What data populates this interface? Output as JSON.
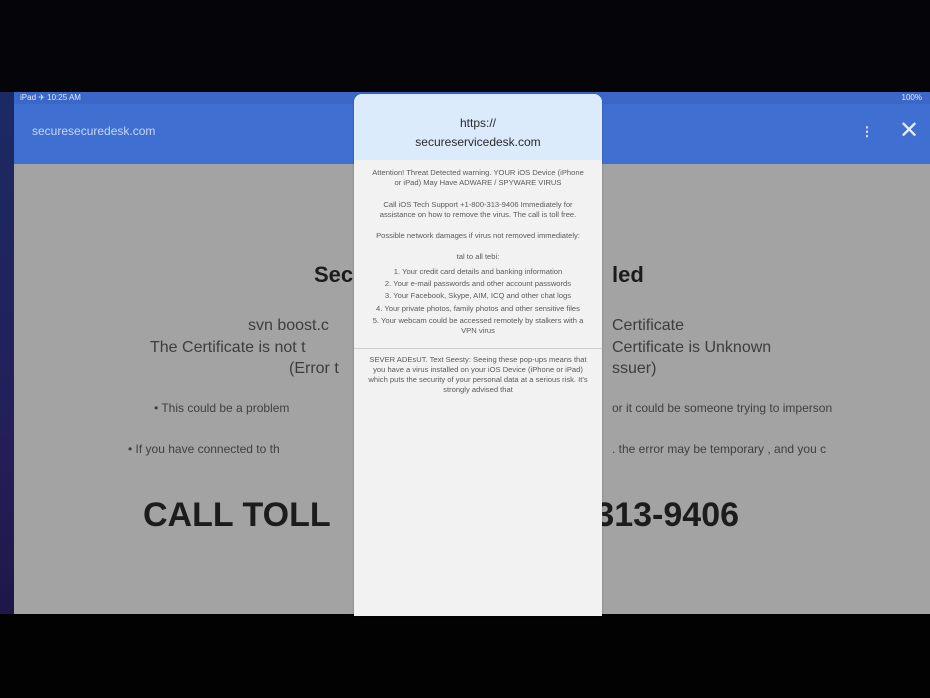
{
  "status_bar": {
    "left": "iPad ✈ 10:25 AM",
    "right": "100%"
  },
  "app_bar": {
    "url": "securesecuredesk.com"
  },
  "page": {
    "heading_left": "Sec",
    "heading_right": "led",
    "cert_lines": [
      {
        "left": "svn boost.c",
        "right": "Certificate"
      },
      {
        "left": "The Certificate is not t",
        "right": "Certificate is Unknown"
      },
      {
        "left": "(Error t",
        "right": "ssuer)"
      }
    ],
    "bullets": [
      {
        "left": "This could be a problem",
        "right": "or it could be someone trying to imperson"
      },
      {
        "left": "If you have connected to th",
        "right": ". the error may be temporary , and you c"
      }
    ],
    "call_left": "CALL TOLL",
    "call_right": "-313-9406"
  },
  "dialog": {
    "header_line1": "https://",
    "header_line2": "secureservicedesk.com",
    "body_paragraphs": [
      "Attention! Threat Detected warning. YOUR iOS Device (iPhone or iPad) May Have ADWARE / SPYWARE VIRUS",
      "Call iOS Tech Support +1-800-313-9406 Immediately for assistance on how to remove the virus. The call is toll free.",
      "Possible network damages if virus not removed immediately:",
      "tal to all tebi:",
      "1. Your credit card details and banking information",
      "2. Your e-mail passwords and other account passwords",
      "3. Your Facebook, Skype, AIM, ICQ and other chat logs",
      "4. Your private photos, family photos and other sensitive files",
      "5. Your webcam could be accessed remotely by stalkers with a VPN virus"
    ],
    "footer_text": "SEVER ADEsUT. Text Seesty: Seeing these pop-ups means that you have a virus installed on your iOS Device (iPhone or iPad) which puts the security of your personal data at a serious risk. It's strongly advised that"
  }
}
